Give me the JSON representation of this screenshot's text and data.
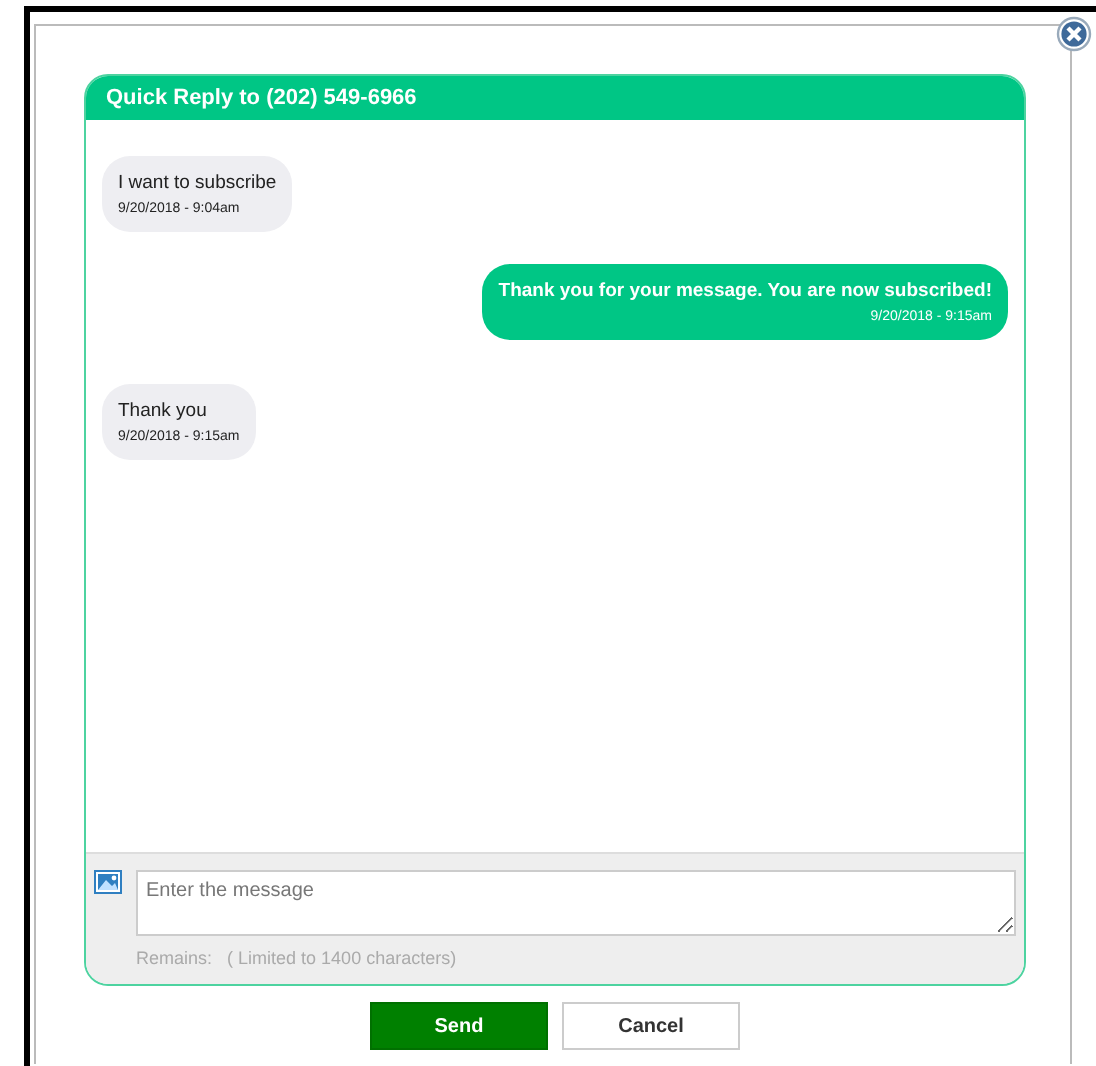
{
  "panel": {
    "title": "Quick Reply to (202) 549-6966"
  },
  "messages": [
    {
      "kind": "incoming",
      "text": "I want to subscribe",
      "time": "9/20/2018 - 9:04am"
    },
    {
      "kind": "outgoing",
      "text": "Thank you for your message. You are now subscribed!",
      "time": "9/20/2018 - 9:15am"
    },
    {
      "kind": "incoming",
      "text": "Thank you",
      "time": "9/20/2018 - 9:15am"
    }
  ],
  "composer": {
    "placeholder": "Enter the message",
    "remains_label": "Remains:",
    "limit_note": "( Limited to 1400 characters)"
  },
  "buttons": [
    {
      "kind": "primary",
      "label": "Send"
    },
    {
      "kind": "secondary",
      "label": "Cancel"
    }
  ]
}
